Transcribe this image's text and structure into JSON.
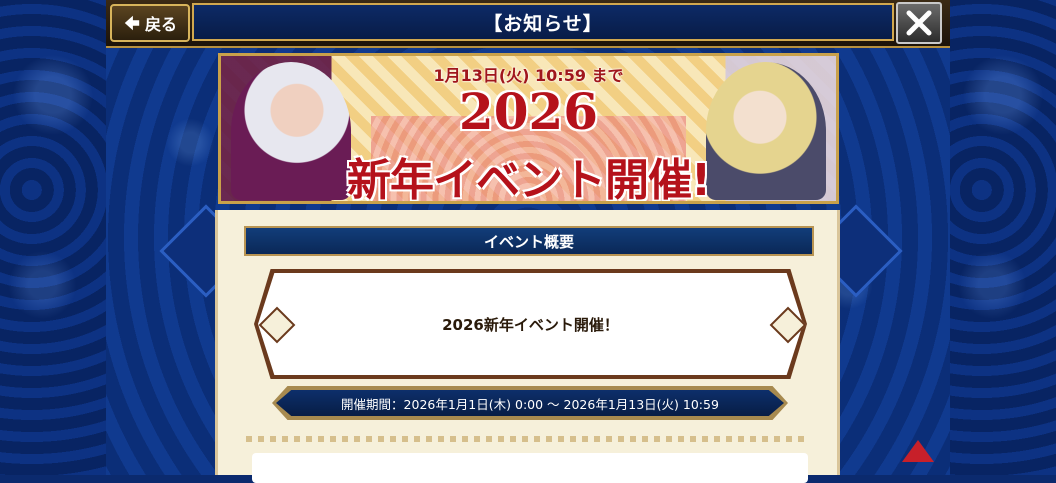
{
  "header": {
    "back_label": "戻る",
    "title": "【お知らせ】"
  },
  "banner": {
    "deadline": "1月13日(火) 10:59 まで",
    "year": "2026",
    "title": "新年イベント開催!"
  },
  "section": {
    "heading": "イベント概要",
    "message": "2026新年イベント開催！",
    "period": "開催期間：2026年1月1日(木) 0:00 ～ 2026年1月13日(火) 10:59"
  },
  "colors": {
    "accent_gold": "#c9a14a",
    "title_navy": "#0d2a66",
    "banner_red": "#b5121b"
  },
  "icons": {
    "back": "arrow-left-icon",
    "close": "close-icon",
    "scroll": "scroll-up-icon"
  }
}
